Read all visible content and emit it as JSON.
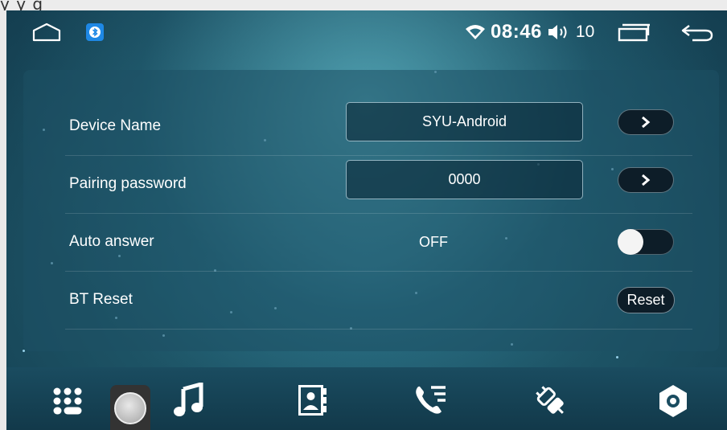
{
  "top_banner": {
    "text": "y                                                          y    g"
  },
  "statusbar": {
    "time": "08:46",
    "volume_level": "10",
    "icons": [
      "home-icon",
      "bluetooth-app-icon",
      "wifi-icon",
      "volume-icon",
      "recent-apps-icon",
      "back-icon"
    ]
  },
  "settings": {
    "device_name": {
      "label": "Device Name",
      "value": "SYU-Android"
    },
    "pairing_password": {
      "label": "Pairing password",
      "value": "0000"
    },
    "auto_answer": {
      "label": "Auto answer",
      "value": "OFF",
      "toggle_on": false
    },
    "bt_reset": {
      "label": "BT Reset",
      "button_label": "Reset"
    }
  },
  "dock": {
    "icons": [
      "dialpad-icon",
      "music-icon",
      "contacts-icon",
      "call-log-icon",
      "connection-icon",
      "settings-icon"
    ]
  },
  "colors": {
    "accent_bg": "#1e5668",
    "button_bg": "#0d1d28"
  }
}
